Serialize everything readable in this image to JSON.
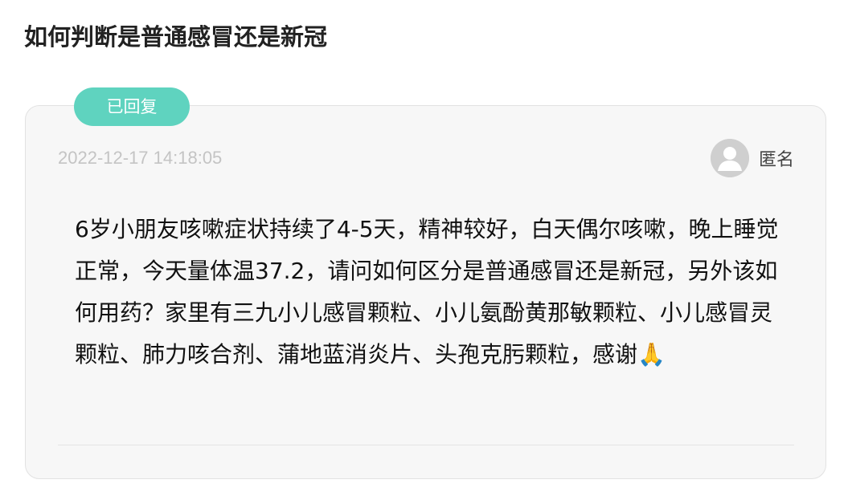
{
  "page": {
    "title": "如何判断是普通感冒还是新冠"
  },
  "question": {
    "status": "已回复",
    "timestamp": "2022-12-17 14:18:05",
    "author": {
      "name": "匿名",
      "avatar_icon": "default-user-avatar-icon"
    },
    "body": "6岁小朋友咳嗽症状持续了4-5天，精神较好，白天偶尔咳嗽，晚上睡觉正常，今天量体温37.2，请问如何区分是普通感冒还是新冠，另外该如何用药？家里有三九小儿感冒颗粒、小儿氨酚黄那敏颗粒、小儿感冒灵颗粒、肺力咳合剂、蒲地蓝消炎片、头孢克肟颗粒，感谢🙏"
  },
  "colors": {
    "badge_bg": "#5fd3bf",
    "card_bg": "#f7f7f7",
    "timestamp": "#c4c4c4"
  }
}
